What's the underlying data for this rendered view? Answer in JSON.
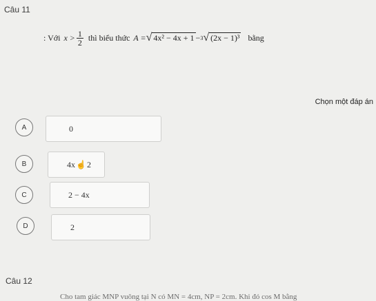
{
  "q11": {
    "title": "Câu 11",
    "stem_prefix": ": Với",
    "cond_var": "x >",
    "cond_num": "1",
    "cond_den": "2",
    "stem_mid": "thì biểu thức",
    "expr_lhs": "A =",
    "sqrt_content": "4x² − 4x + 1",
    "minus": "−",
    "cbrt_index": "3",
    "cbrt_content": "(2x − 1)³",
    "stem_suffix": "bằng"
  },
  "prompt": "Chọn một đáp án",
  "options": [
    {
      "letter": "A",
      "value": "0"
    },
    {
      "letter": "B",
      "value_left": "4x",
      "value_right": "2"
    },
    {
      "letter": "C",
      "value": "2 − 4x"
    },
    {
      "letter": "D",
      "value": "2"
    }
  ],
  "q12": {
    "title": "Câu 12",
    "text": "Cho tam giác MNP vuông tại N có MN = 4cm, NP = 2cm. Khi đó cos M bằng"
  },
  "icons": {
    "cursor": "hand-pointer-icon"
  }
}
